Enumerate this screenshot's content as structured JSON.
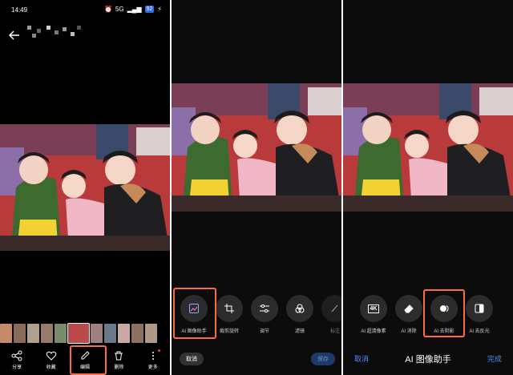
{
  "status": {
    "time": "14:49",
    "battery": "92",
    "signal": "5G"
  },
  "viewer": {
    "actions": [
      {
        "label": "分享",
        "icon": "share-icon"
      },
      {
        "label": "收藏",
        "icon": "heart-icon"
      },
      {
        "label": "编辑",
        "icon": "pencil-icon"
      },
      {
        "label": "删除",
        "icon": "trash-icon"
      },
      {
        "label": "更多",
        "icon": "more-icon"
      }
    ]
  },
  "editor": {
    "tools": [
      {
        "label": "AI 图像助手",
        "icon": "ai-image-icon"
      },
      {
        "label": "裁剪旋转",
        "icon": "crop-icon"
      },
      {
        "label": "调节",
        "icon": "sliders-icon"
      },
      {
        "label": "滤镜",
        "icon": "filter-icon"
      },
      {
        "label": "标注",
        "icon": "markup-icon"
      }
    ],
    "cancel": "取消",
    "save": "保存"
  },
  "ai_assistant": {
    "title": "AI 图像助手",
    "cancel": "取消",
    "done": "完成",
    "tools": [
      {
        "label": "AI 超清像素",
        "icon": "4k-icon",
        "badge": "4K"
      },
      {
        "label": "AI 消除",
        "icon": "eraser-icon"
      },
      {
        "label": "AI 去阴影",
        "icon": "shadow-icon"
      },
      {
        "label": "AI 去反光",
        "icon": "reflection-icon"
      }
    ]
  },
  "colors": {
    "highlight": "#ff6b3d",
    "accent": "#4a8df8"
  }
}
